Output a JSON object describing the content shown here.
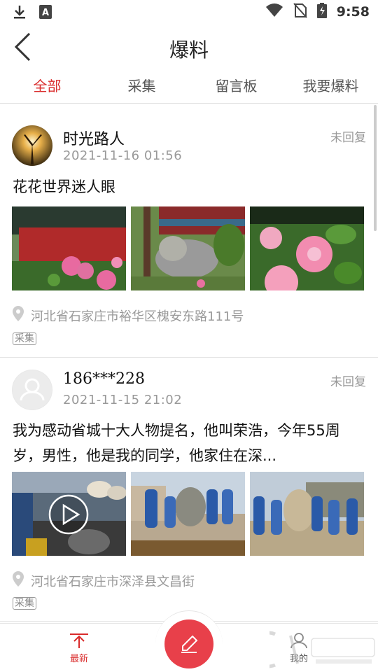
{
  "status_bar": {
    "time": "9:58"
  },
  "header": {
    "title": "爆料"
  },
  "tabs": [
    {
      "label": "全部",
      "active": true
    },
    {
      "label": "采集",
      "active": false
    },
    {
      "label": "留言板",
      "active": false
    },
    {
      "label": "我要爆料",
      "active": false
    }
  ],
  "posts": [
    {
      "username": "时光路人",
      "timestamp": "2021-11-16  01:56",
      "reply_status": "未回复",
      "text": "花花世界迷人眼",
      "location": "河北省石家庄市裕华区槐安东路111号",
      "tag": "采集"
    },
    {
      "username": "186***228",
      "timestamp": "2021-11-15  21:02",
      "reply_status": "未回复",
      "text_line1": "我为感动省城十大人物提名，他叫荣浩，今年55周",
      "text_line2": "岁，男性，他是我的同学，他家住在深...",
      "location": "河北省石家庄市深泽县文昌街",
      "tag": "采集"
    }
  ],
  "bottom_nav": {
    "latest_label": "最新",
    "mine_label": "我的"
  },
  "colors": {
    "accent": "#d92b2b",
    "compose": "#e8404a"
  }
}
